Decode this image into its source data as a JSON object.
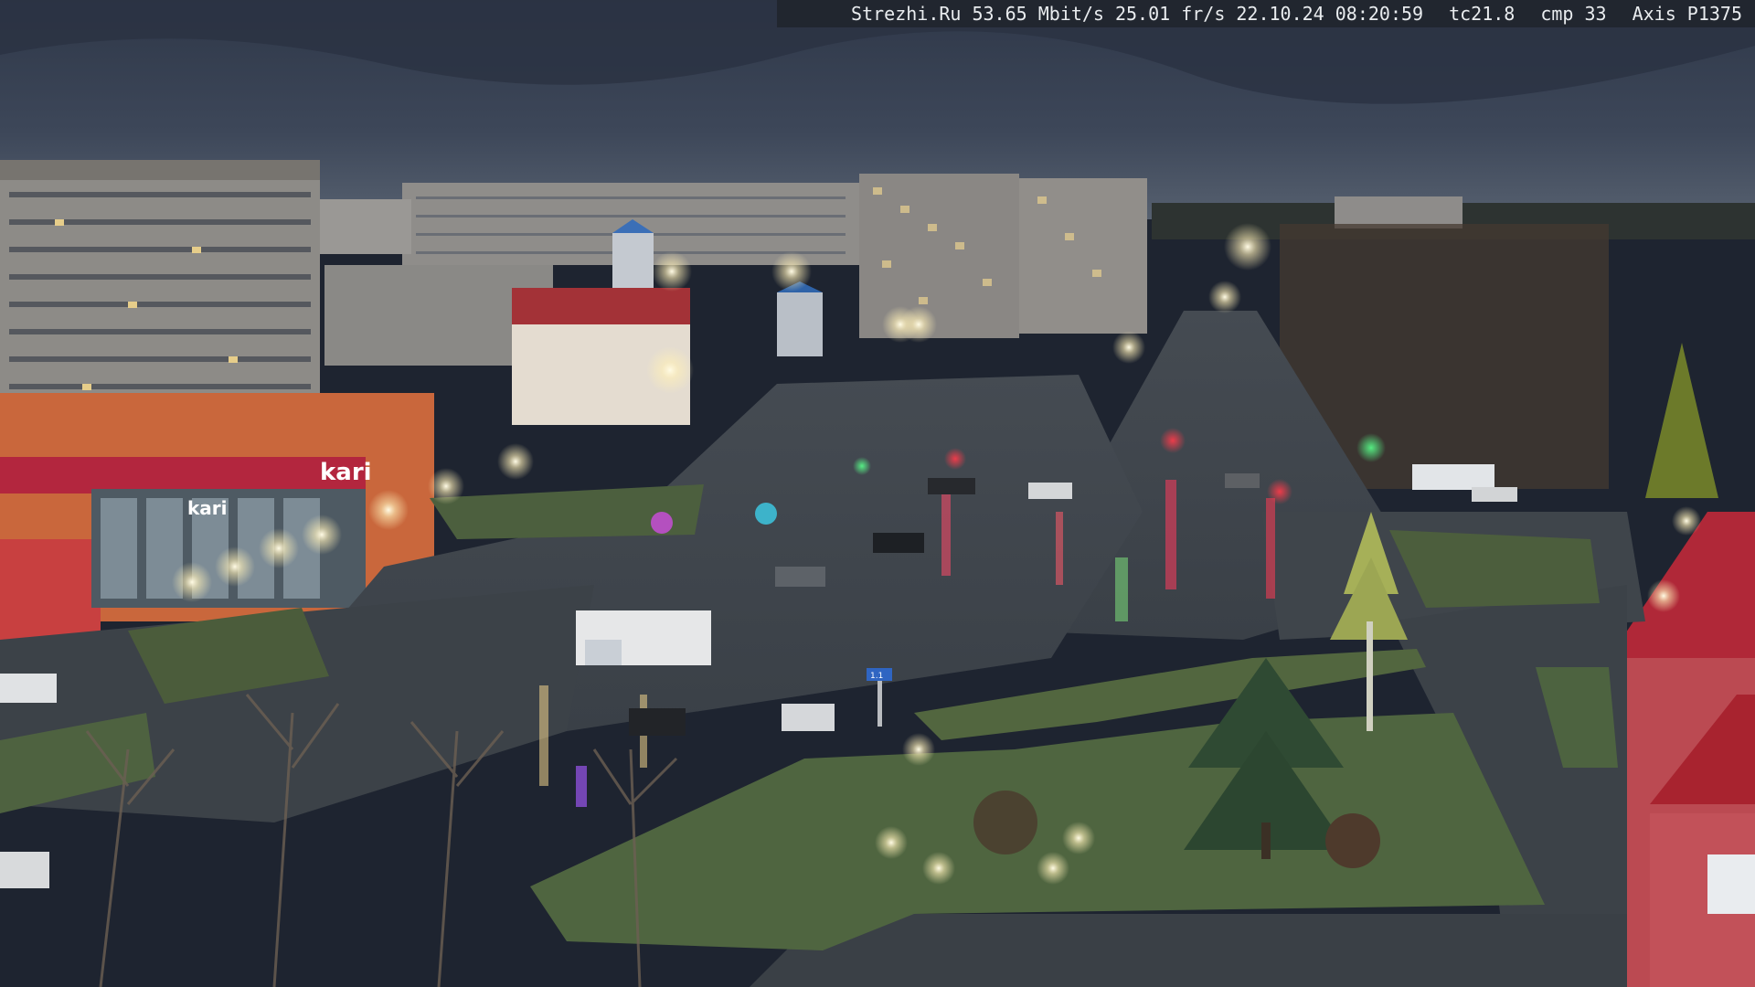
{
  "overlay": {
    "site": "Strezhi.Ru",
    "bitrate": "53.65 Mbit/s",
    "framerate": "25.01 fr/s",
    "datetime": "22.10.24 08:20:59",
    "tc": "tc21.8",
    "cmp": "cmp 33",
    "camera": "Axis P1375"
  },
  "signage": {
    "store_big": "kari",
    "store_small": "kari"
  },
  "road_sign": "1.1",
  "colors": {
    "sky": "#3a4556",
    "road": "#3e444b",
    "grass": "#4f6540",
    "building_gray": "#8c8a86",
    "store_orange": "#c9673c",
    "store_red": "#b3263e",
    "streetlight": "#fff6d8"
  }
}
